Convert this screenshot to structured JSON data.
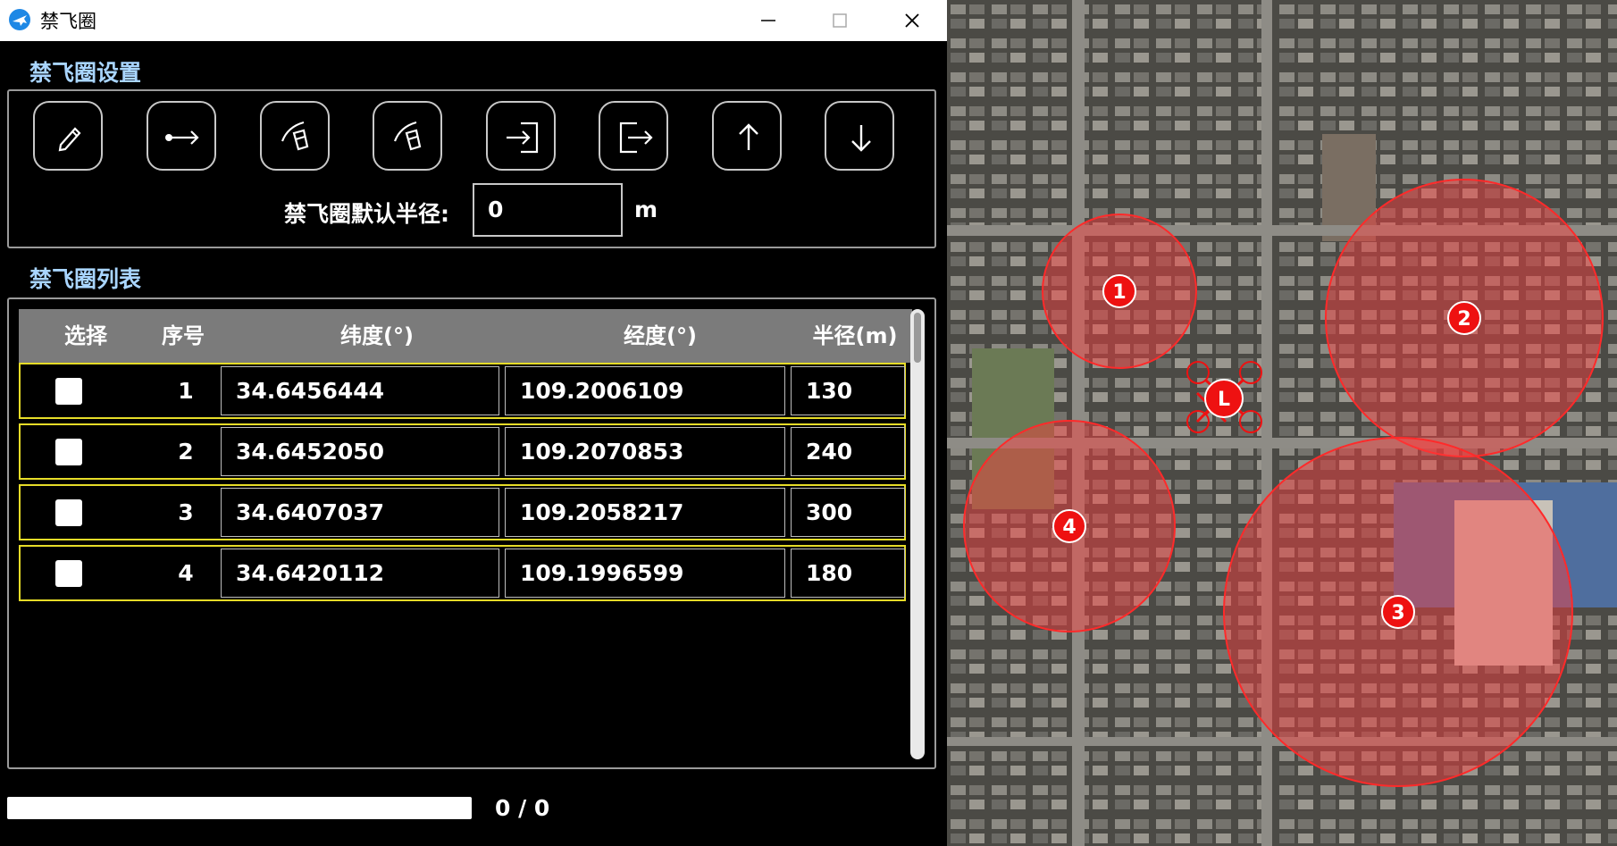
{
  "window": {
    "title": "禁飞圈",
    "app_icon": "airplane-icon",
    "controls": [
      "minimize-icon",
      "maximize-icon",
      "close-icon"
    ]
  },
  "settings": {
    "title": "禁飞圈设置",
    "tools": [
      {
        "name": "pencil-icon"
      },
      {
        "name": "dot-arrow-icon"
      },
      {
        "name": "eraser-icon"
      },
      {
        "name": "eraser-alt-icon"
      },
      {
        "name": "import-icon"
      },
      {
        "name": "export-icon"
      },
      {
        "name": "arrow-up-icon"
      },
      {
        "name": "arrow-down-icon"
      }
    ],
    "radius_label": "禁飞圈默认半径:",
    "radius_value": "0",
    "radius_unit": "m"
  },
  "list": {
    "title": "禁飞圈列表",
    "columns": [
      "选择",
      "序号",
      "纬度(°)",
      "经度(°)",
      "半径(m)"
    ],
    "rows": [
      {
        "index": "1",
        "lat": "34.6456444",
        "lon": "109.2006109",
        "radius": "130",
        "checked": false
      },
      {
        "index": "2",
        "lat": "34.6452050",
        "lon": "109.2070853",
        "radius": "240",
        "checked": false
      },
      {
        "index": "3",
        "lat": "34.6407037",
        "lon": "109.2058217",
        "radius": "300",
        "checked": false
      },
      {
        "index": "4",
        "lat": "34.6420112",
        "lon": "109.1996599",
        "radius": "180",
        "checked": false
      }
    ]
  },
  "progress": {
    "value": 0,
    "text": "0 / 0"
  },
  "map": {
    "zones": [
      "1",
      "2",
      "3",
      "4"
    ],
    "home_marker": "L",
    "zone_color": "#ff3b3b"
  }
}
